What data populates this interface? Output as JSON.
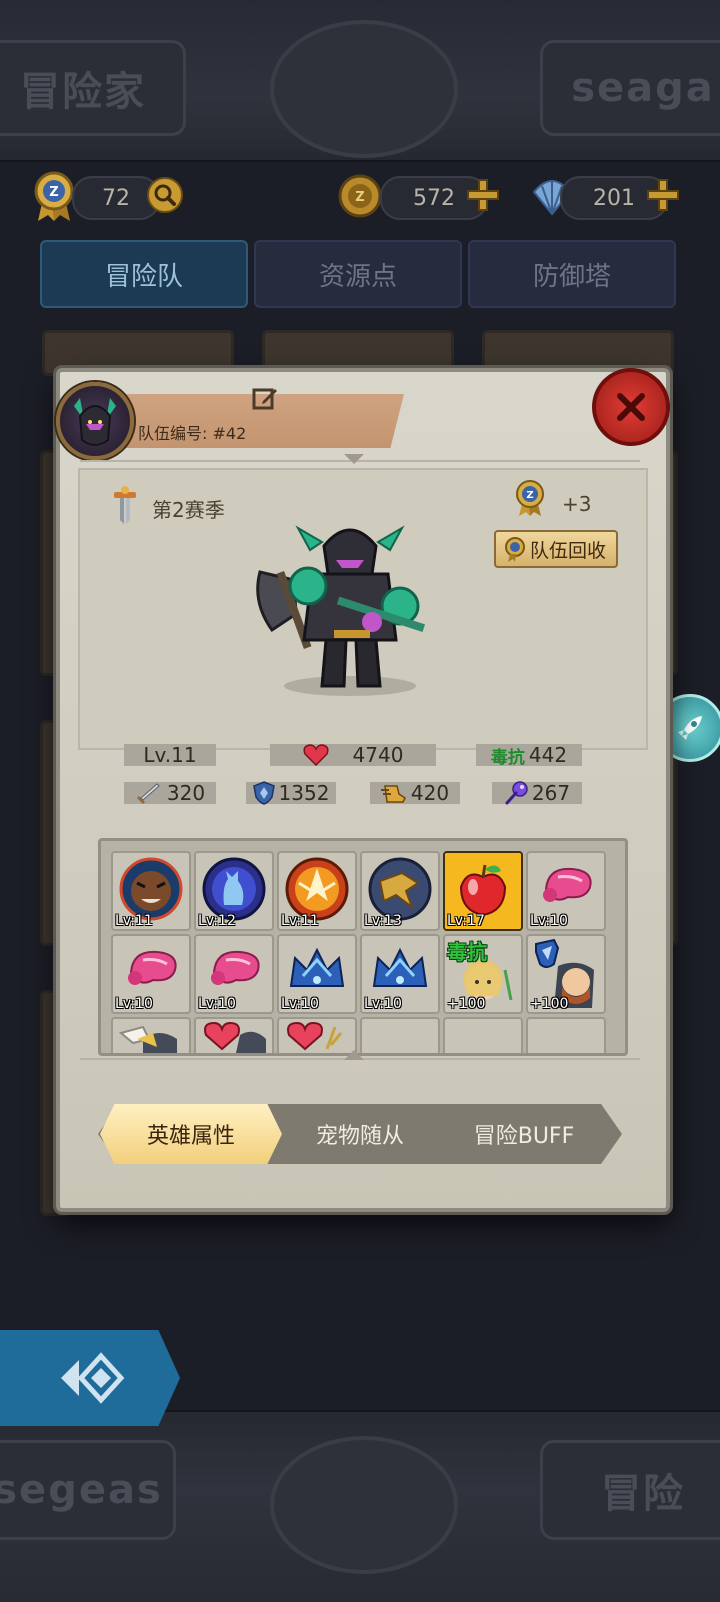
{
  "banner": {
    "left_text": "冒险家",
    "right_text": "seaga",
    "bottom_left_text": "segeas",
    "bottom_right_text": "冒险"
  },
  "currencies": {
    "badge_value": "72",
    "coin_value": "572",
    "shell_value": "201"
  },
  "tabs": [
    {
      "label": "冒险队"
    },
    {
      "label": "资源点"
    },
    {
      "label": "防御塔"
    }
  ],
  "panel": {
    "team_id": "队伍编号: #42",
    "season": "第2赛季",
    "badge_bonus": "+3",
    "recycle_label": "队伍回收"
  },
  "stats": {
    "level": "Lv.11",
    "hp": "4740",
    "poison_res_label": "毒抗",
    "poison_res": "442",
    "attack": "320",
    "defense": "1352",
    "speed": "420",
    "magic": "267"
  },
  "items": [
    {
      "label": "Lv:11",
      "icon": "warrior-face-icon"
    },
    {
      "label": "Lv:12",
      "icon": "cat-silhouette-icon"
    },
    {
      "label": "Lv:11",
      "icon": "phoenix-icon"
    },
    {
      "label": "Lv:13",
      "icon": "golden-bird-icon"
    },
    {
      "label": "Lv:17",
      "icon": "apple-icon"
    },
    {
      "label": "Lv:10",
      "icon": "meat-icon"
    },
    {
      "label": "Lv:10",
      "icon": "meat-icon"
    },
    {
      "label": "Lv:10",
      "icon": "meat-icon"
    },
    {
      "label": "Lv:10",
      "icon": "blue-crown-icon"
    },
    {
      "label": "Lv:10",
      "icon": "blue-crown-icon"
    },
    {
      "label": "+100",
      "icon": "poison-res-hero-icon",
      "tag": "毒抗"
    },
    {
      "label": "+100",
      "icon": "shield-hero-icon"
    }
  ],
  "sub_tabs": [
    {
      "label": "英雄属性"
    },
    {
      "label": "宠物随从"
    },
    {
      "label": "冒险BUFF"
    }
  ],
  "colors": {
    "panel": "#d9d6cb",
    "accent_gold": "#f2cf7c",
    "tab_active": "#1d3a55",
    "close_red": "#d2332b"
  }
}
